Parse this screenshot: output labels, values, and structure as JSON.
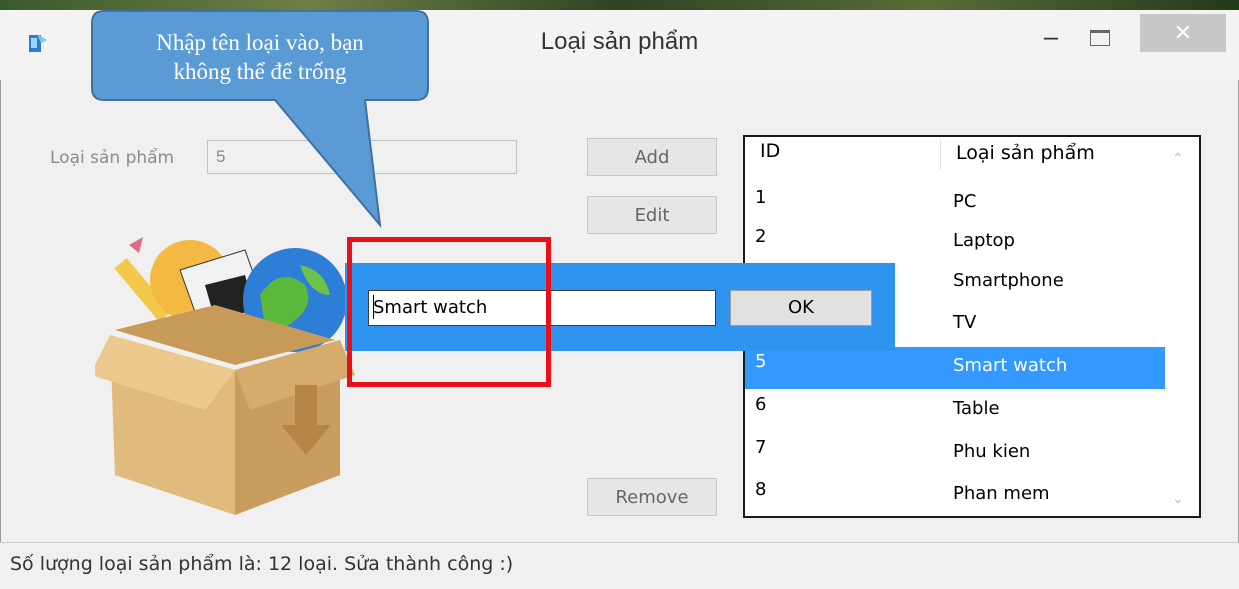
{
  "window": {
    "title": "Loại sản phẩm",
    "minimize_icon": "minimize-icon",
    "maximize_icon": "maximize-icon",
    "close_icon": "close-icon",
    "close_glyph": "✕",
    "minimize_glyph": "–"
  },
  "callout": {
    "line1": "Nhập tên loại vào, bạn",
    "line2": "không thể để trống",
    "color": "#5b9bd5"
  },
  "form": {
    "label": "Loại sản phẩm",
    "value": "5",
    "add_label": "Add",
    "edit_label": "Edit",
    "remove_label": "Remove"
  },
  "list": {
    "columns": [
      "ID",
      "Loại sản phẩm"
    ],
    "rows": [
      {
        "id": "1",
        "name": "PC"
      },
      {
        "id": "2",
        "name": "Laptop"
      },
      {
        "id": "",
        "name": "Smartphone"
      },
      {
        "id": "",
        "name": "TV"
      },
      {
        "id": "5",
        "name": "Smart watch",
        "selected": true
      },
      {
        "id": "6",
        "name": "Table"
      },
      {
        "id": "7",
        "name": "Phu kien"
      },
      {
        "id": "8",
        "name": "Phan mem"
      }
    ],
    "selection_color": "#3399ff",
    "scroll_up_glyph": "⌃",
    "scroll_down_glyph": "⌄"
  },
  "popup": {
    "input_value": "Smart watch",
    "ok_label": "OK",
    "background": "#2f93f0",
    "highlight_color": "#e8101a"
  },
  "status": {
    "text": "Số lượng loại sản phẩm là: 12 loại.  Sửa thành công :)"
  }
}
